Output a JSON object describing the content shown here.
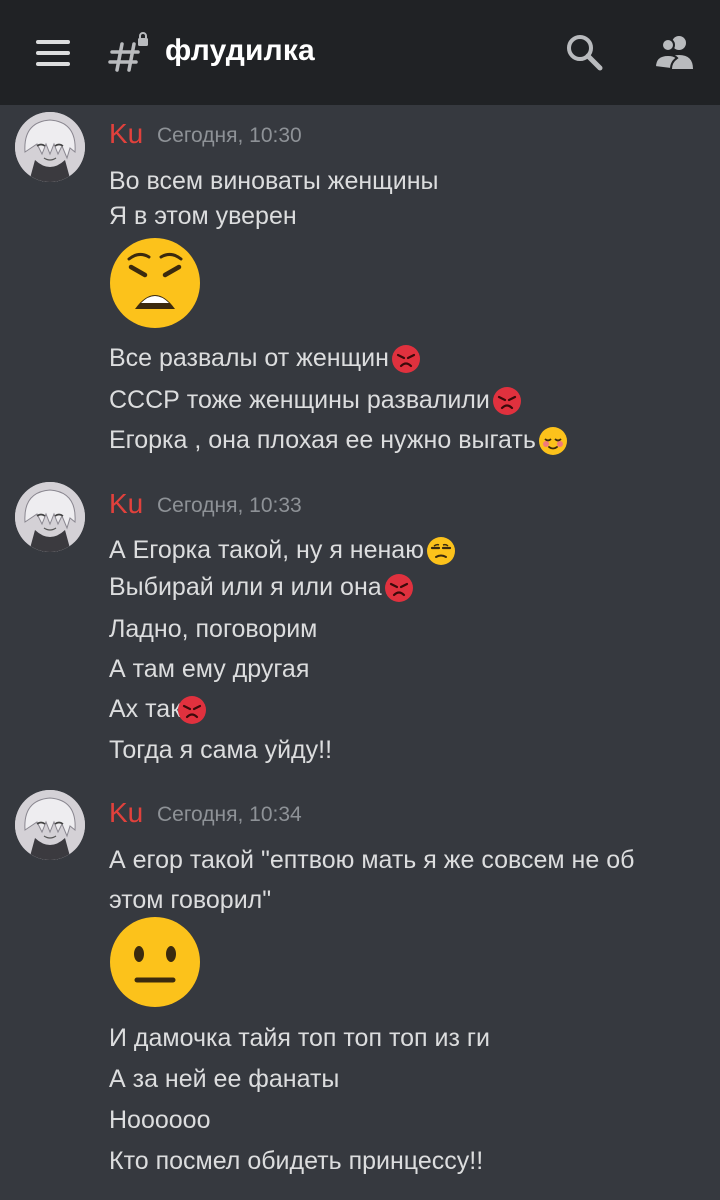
{
  "header": {
    "channel_name": "флудилка",
    "colors": {
      "header_bg": "#202225",
      "body_bg": "#36393f"
    }
  },
  "icons": {
    "menu": "hamburger-icon",
    "channel": "text-channel-locked-icon",
    "search": "search-icon",
    "members": "members-icon"
  },
  "messages": [
    {
      "author": "Ku",
      "timestamp": "Сегодня, 10:30",
      "lines": [
        "Во всем виноваты женщины",
        "Я в этом уверен"
      ],
      "big_emoji": "weary-face",
      "lines_after": [
        "Все развалы от женщин",
        "СССР тоже женщины развалили",
        "Егорка , она плохая ее нужно выгать"
      ],
      "emojis_after": [
        "angry-face",
        "angry-face",
        "relieved-face"
      ]
    },
    {
      "author": "Ku",
      "timestamp": "Сегодня, 10:33",
      "lines": [
        "А Егорка такой, ну я ненаю",
        "Выбирай или я или она",
        "Ладно, поговорим",
        "А там ему другая",
        "Ах так",
        "Тогда я сама уйду!!"
      ],
      "emojis": [
        "unamused-face",
        "angry-face",
        "",
        "",
        "angry-face",
        ""
      ]
    },
    {
      "author": "Ku",
      "timestamp": "Сегодня, 10:34",
      "lines": [
        "А егор такой  \"ептвою мать я же совсем не об",
        "этом говорил\""
      ],
      "big_emoji": "neutral-face",
      "lines_after": [
        "И дамочка тайя топ топ топ из ги",
        "А за ней ее фанаты",
        "Ноооооо",
        "Кто посмел обидеть принцессу!!"
      ]
    }
  ],
  "author_color": "#e0413c"
}
